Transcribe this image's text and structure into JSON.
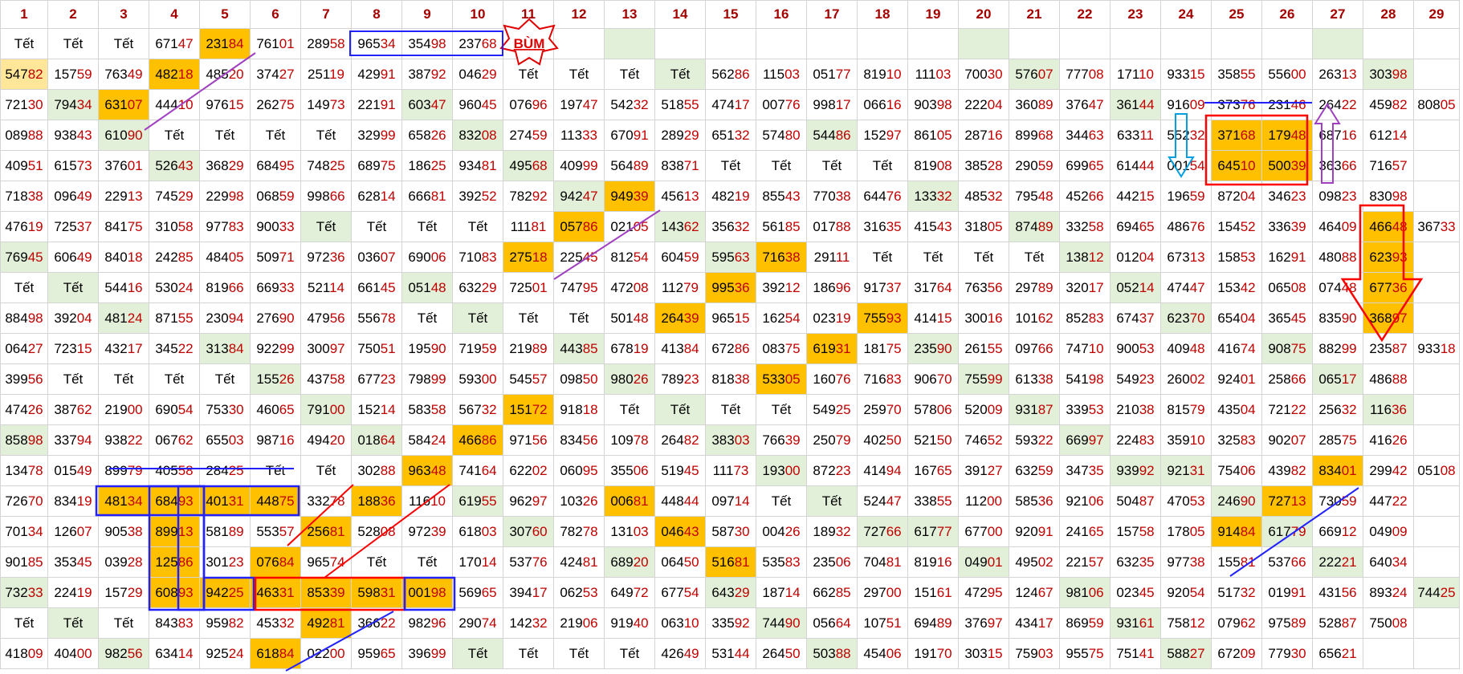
{
  "columns": [
    "1",
    "2",
    "3",
    "4",
    "5",
    "6",
    "7",
    "8",
    "9",
    "10",
    "11",
    "12",
    "13",
    "14",
    "15",
    "16",
    "17",
    "18",
    "19",
    "20",
    "21",
    "22",
    "23",
    "24",
    "25",
    "26",
    "27",
    "28",
    "29"
  ],
  "rows": [
    [
      "Tết",
      "Tết",
      "Tết",
      "67147",
      "23184",
      "76101",
      "28958",
      "96534",
      "35498",
      "23768",
      "BÙM",
      "",
      "",
      "",
      "",
      "",
      "",
      "",
      "",
      "",
      "",
      "",
      "",
      "",
      "",
      "",
      "",
      "",
      ""
    ],
    [
      "54782",
      "15759",
      "76349",
      "48218",
      "48520",
      "37427",
      "25119",
      "42991",
      "38792",
      "04629",
      "Tết",
      "Tết",
      "Tết",
      "Tết",
      "56286",
      "11503",
      "05177",
      "81910",
      "11103",
      "70030",
      "57607",
      "77708",
      "17110",
      "93315",
      "35855",
      "55600",
      "26313",
      "30398",
      ""
    ],
    [
      "72130",
      "79434",
      "63107",
      "44410",
      "97615",
      "26275",
      "14973",
      "22191",
      "60347",
      "96045",
      "07696",
      "19747",
      "54232",
      "51855",
      "47417",
      "00776",
      "99817",
      "06616",
      "90398",
      "22204",
      "36089",
      "37647",
      "36144",
      "91609",
      "37376",
      "23146",
      "26422",
      "45982",
      "80805"
    ],
    [
      "08988",
      "93843",
      "61090",
      "Tết",
      "Tết",
      "Tết",
      "Tết",
      "32999",
      "65826",
      "83208",
      "27459",
      "11333",
      "67091",
      "28929",
      "65132",
      "57480",
      "54486",
      "15297",
      "86105",
      "28716",
      "89968",
      "34463",
      "63311",
      "55232",
      "37168",
      "17948",
      "68716",
      "61214",
      ""
    ],
    [
      "40951",
      "61573",
      "37601",
      "52643",
      "36829",
      "68495",
      "74825",
      "68975",
      "18625",
      "93481",
      "49568",
      "40999",
      "56489",
      "83871",
      "Tết",
      "Tết",
      "Tết",
      "Tết",
      "81908",
      "38528",
      "29059",
      "69965",
      "61444",
      "00154",
      "64510",
      "50039",
      "36366",
      "71657",
      ""
    ],
    [
      "71838",
      "09649",
      "22913",
      "74529",
      "22998",
      "06859",
      "99866",
      "62814",
      "66681",
      "39252",
      "78292",
      "94247",
      "94939",
      "45613",
      "48219",
      "85543",
      "77038",
      "64476",
      "13332",
      "48532",
      "79548",
      "45266",
      "44215",
      "19659",
      "87204",
      "34623",
      "09823",
      "83098",
      ""
    ],
    [
      "47619",
      "72537",
      "84175",
      "31058",
      "97783",
      "90033",
      "Tết",
      "Tết",
      "Tết",
      "Tết",
      "11181",
      "05786",
      "02105",
      "14362",
      "35632",
      "56185",
      "01788",
      "31635",
      "41543",
      "31805",
      "87489",
      "33258",
      "69465",
      "48676",
      "15452",
      "33639",
      "46409",
      "46648",
      "36733"
    ],
    [
      "76945",
      "60649",
      "84018",
      "24285",
      "48405",
      "50971",
      "97236",
      "03607",
      "69006",
      "71083",
      "27518",
      "22545",
      "81254",
      "60459",
      "59563",
      "71638",
      "29111",
      "Tết",
      "Tết",
      "Tết",
      "Tết",
      "13812",
      "01204",
      "67313",
      "15853",
      "16291",
      "48088",
      "62393",
      ""
    ],
    [
      "Tết",
      "Tết",
      "54416",
      "53024",
      "81966",
      "66933",
      "52114",
      "66145",
      "05148",
      "63229",
      "72501",
      "74795",
      "47208",
      "11279",
      "99536",
      "39212",
      "18696",
      "91737",
      "31764",
      "76356",
      "29789",
      "32017",
      "05214",
      "47447",
      "15342",
      "06508",
      "07448",
      "67736",
      ""
    ],
    [
      "88498",
      "39204",
      "48124",
      "87155",
      "23094",
      "27690",
      "47956",
      "55678",
      "Tết",
      "Tết",
      "Tết",
      "Tết",
      "50148",
      "26439",
      "96515",
      "16254",
      "02319",
      "75593",
      "41415",
      "30016",
      "10162",
      "85283",
      "67437",
      "62370",
      "65404",
      "36545",
      "83590",
      "36897",
      ""
    ],
    [
      "06427",
      "72315",
      "43217",
      "34522",
      "31384",
      "92299",
      "30097",
      "75051",
      "19590",
      "71959",
      "21989",
      "44385",
      "67819",
      "41384",
      "67286",
      "08375",
      "61931",
      "18175",
      "23590",
      "26155",
      "09766",
      "74710",
      "90053",
      "40948",
      "41674",
      "90875",
      "88299",
      "23587",
      "93318"
    ],
    [
      "39956",
      "Tết",
      "Tết",
      "Tết",
      "Tết",
      "15526",
      "43758",
      "67723",
      "79899",
      "59300",
      "54557",
      "09850",
      "98026",
      "78923",
      "81838",
      "53305",
      "16076",
      "71683",
      "90670",
      "75599",
      "61338",
      "54198",
      "54923",
      "26002",
      "92401",
      "25866",
      "06517",
      "48688",
      ""
    ],
    [
      "47426",
      "38762",
      "21900",
      "69054",
      "75330",
      "46065",
      "79100",
      "15214",
      "58358",
      "56732",
      "15172",
      "91818",
      "Tết",
      "Tết",
      "Tết",
      "Tết",
      "54925",
      "25970",
      "57806",
      "52009",
      "93187",
      "33953",
      "21038",
      "81579",
      "43504",
      "72122",
      "25632",
      "11636",
      ""
    ],
    [
      "85898",
      "33794",
      "93822",
      "06762",
      "65503",
      "98716",
      "49420",
      "01864",
      "58424",
      "46686",
      "97156",
      "83456",
      "10978",
      "26482",
      "38303",
      "76639",
      "25079",
      "40250",
      "52150",
      "74652",
      "59322",
      "66997",
      "22483",
      "35910",
      "32583",
      "90207",
      "28575",
      "41626",
      ""
    ],
    [
      "13478",
      "01549",
      "89979",
      "40558",
      "28425",
      "Tết",
      "Tết",
      "30288",
      "96348",
      "74164",
      "62202",
      "06095",
      "35506",
      "51945",
      "11173",
      "19300",
      "87223",
      "41494",
      "16765",
      "39127",
      "63259",
      "34735",
      "93992",
      "92131",
      "75406",
      "43982",
      "83401",
      "29942",
      "05108"
    ],
    [
      "72670",
      "83419",
      "48134",
      "68493",
      "40131",
      "44875",
      "33278",
      "18836",
      "11610",
      "61955",
      "96297",
      "10326",
      "00681",
      "44844",
      "09714",
      "Tết",
      "Tết",
      "52447",
      "33855",
      "11200",
      "58536",
      "92106",
      "50487",
      "47053",
      "24690",
      "72713",
      "73059",
      "44722",
      ""
    ],
    [
      "70134",
      "12607",
      "90538",
      "89913",
      "58189",
      "55357",
      "25681",
      "52808",
      "97239",
      "61803",
      "30760",
      "78278",
      "13103",
      "04643",
      "58730",
      "00426",
      "18932",
      "72766",
      "61777",
      "67700",
      "92091",
      "24165",
      "15758",
      "17805",
      "91484",
      "61779",
      "66912",
      "04909",
      ""
    ],
    [
      "90185",
      "35345",
      "03928",
      "12586",
      "30123",
      "07684",
      "96574",
      "Tết",
      "Tết",
      "17014",
      "53776",
      "42481",
      "68920",
      "06450",
      "51681",
      "53583",
      "23506",
      "70481",
      "81916",
      "04901",
      "49502",
      "22157",
      "63235",
      "97738",
      "15581",
      "53766",
      "22221",
      "64034",
      ""
    ],
    [
      "73233",
      "22419",
      "15729",
      "60893",
      "94225",
      "46331",
      "85339",
      "59831",
      "00198",
      "56965",
      "39417",
      "06253",
      "64972",
      "67754",
      "64329",
      "18714",
      "66285",
      "29700",
      "15161",
      "47295",
      "12467",
      "98106",
      "02345",
      "92054",
      "51732",
      "01991",
      "43156",
      "89324",
      "74425"
    ],
    [
      "Tết",
      "Tết",
      "Tết",
      "84383",
      "95982",
      "45332",
      "49281",
      "36622",
      "98296",
      "29074",
      "14232",
      "21906",
      "91940",
      "06310",
      "33592",
      "74490",
      "05664",
      "10751",
      "69489",
      "37697",
      "43417",
      "86959",
      "93161",
      "75812",
      "07962",
      "97589",
      "52887",
      "75008",
      ""
    ],
    [
      "41809",
      "40400",
      "98256",
      "63414",
      "92524",
      "61884",
      "02200",
      "95965",
      "39699",
      "Tết",
      "Tết",
      "Tết",
      "Tết",
      "42649",
      "53144",
      "26450",
      "50388",
      "45406",
      "19170",
      "30315",
      "75903",
      "95575",
      "75141",
      "58827",
      "67209",
      "77930",
      "65621",
      "",
      ""
    ]
  ],
  "highlights": {
    "orange": [
      "0-4",
      "2-2",
      "1-3",
      "7-10",
      "6-11",
      "5-12",
      "15-2",
      "15-3",
      "15-4",
      "15-5",
      "16-3",
      "17-3",
      "18-3",
      "18-4",
      "18-5",
      "18-6",
      "18-7",
      "18-8",
      "17-5",
      "16-6",
      "19-6",
      "20-5",
      "15-7",
      "14-8",
      "13-9",
      "8-14",
      "9-13",
      "7-15",
      "10-16",
      "11-15",
      "9-17",
      "12-10",
      "16-13",
      "15-12",
      "17-14",
      "3-24",
      "3-25",
      "4-24",
      "4-25",
      "6-27",
      "7-27",
      "8-27",
      "9-27",
      "14-26",
      "15-25",
      "16-24"
    ],
    "yellow": [
      "1-0"
    ],
    "green": [
      "0-12",
      "0-19",
      "0-26",
      "1-13",
      "1-20",
      "1-27",
      "2-1",
      "2-8",
      "2-22",
      "3-2",
      "3-9",
      "3-16",
      "4-3",
      "4-10",
      "5-11",
      "5-18",
      "6-6",
      "6-13",
      "6-20",
      "7-0",
      "7-14",
      "7-21",
      "8-1",
      "8-8",
      "8-22",
      "9-2",
      "9-9",
      "9-23",
      "10-4",
      "10-11",
      "10-18",
      "10-25",
      "11-5",
      "11-12",
      "11-19",
      "11-26",
      "12-6",
      "12-13",
      "12-20",
      "12-27",
      "13-0",
      "13-7",
      "13-14",
      "13-21",
      "14-15",
      "14-22",
      "14-23",
      "15-9",
      "15-16",
      "15-24",
      "16-10",
      "16-17",
      "16-18",
      "16-25",
      "17-12",
      "17-19",
      "17-26",
      "18-0",
      "18-14",
      "18-21",
      "18-28",
      "19-1",
      "19-15",
      "19-22",
      "20-2",
      "20-9",
      "20-16",
      "20-23"
    ]
  },
  "annotation_label": "BÙM"
}
